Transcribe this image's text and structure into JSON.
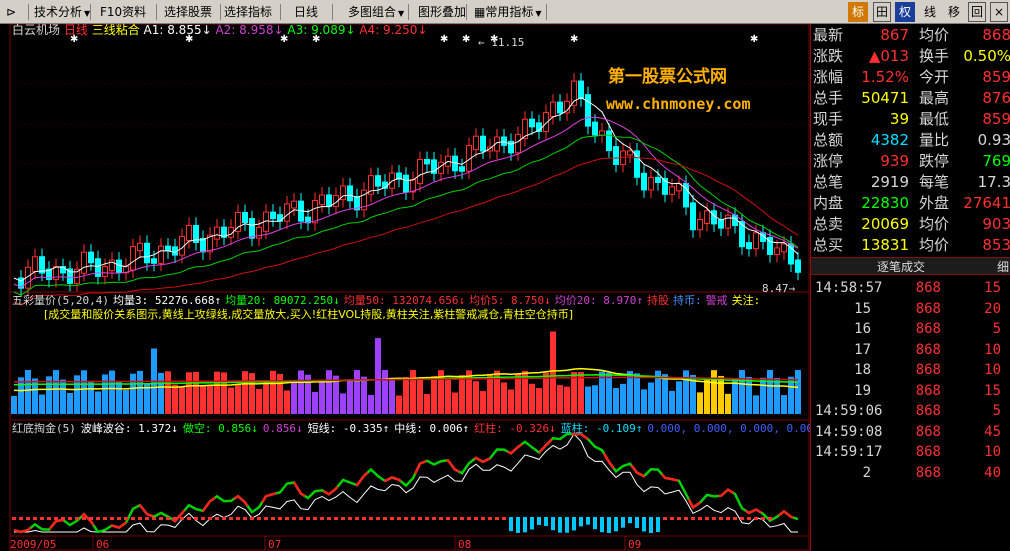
{
  "toolbar": {
    "menus": [
      "技术分析",
      "F10资料",
      "选择股票",
      "选择指标",
      "日线",
      "多图组合",
      "图形叠加",
      "常用指标"
    ],
    "right_tabs": [
      "标",
      "田",
      "权",
      "线",
      "移",
      "回"
    ],
    "active_tab": "标"
  },
  "title": {
    "stock_name": "白云机场",
    "period": "日线",
    "indicator": "三线粘合",
    "a1": "A1: 8.855↓",
    "a2": "A2: 8.958↓",
    "a3": "A3: 9.089↓",
    "a4": "A4: 9.250↓"
  },
  "watermark": {
    "line1": "第一股票公式网",
    "line2": "www.chnmoney.com"
  },
  "price_marks": {
    "high": "11.15",
    "low": "8.47"
  },
  "volume_pane": {
    "line1": [
      {
        "text": "五彩量价(5,20,4)",
        "color": "#d6d6d6"
      },
      {
        "text": "均量3: 52276.668↑",
        "color": "#ffffff"
      },
      {
        "text": "均量20: 89072.250↓",
        "color": "#00ff00"
      },
      {
        "text": "均量50: 132074.656↓",
        "color": "#ff3030"
      },
      {
        "text": "均价5: 8.750↓",
        "color": "#ff3030"
      },
      {
        "text": "均价20: 8.970↑",
        "color": "#d040d0"
      },
      {
        "text": "持股",
        "color": "#ff3030"
      },
      {
        "text": "持币:",
        "color": "#4090ff"
      },
      {
        "text": "警戒",
        "color": "#d040d0"
      },
      {
        "text": "关注:",
        "color": "#ffff00"
      }
    ],
    "line2": "[成交量和股价关系图示,黄线上攻绿线,成交量放大,买入!红柱VOL持股,黄柱关注,紫柱警戒减仓,青柱空仓持币]"
  },
  "macd_pane": {
    "items": [
      {
        "text": "红底掏金(5)",
        "color": "#d6d6d6"
      },
      {
        "text": "波峰波谷: 1.372↓",
        "color": "#ffffff"
      },
      {
        "text": "做空: 0.856↓",
        "color": "#00ff00"
      },
      {
        "text": "0.856↓",
        "color": "#d040d0"
      },
      {
        "text": "短线: -0.335↑",
        "color": "#ffffff"
      },
      {
        "text": "中线: 0.006↑",
        "color": "#ffffff"
      },
      {
        "text": "红柱: -0.326↓",
        "color": "#ff3030"
      },
      {
        "text": "蓝柱: -0.109↑",
        "color": "#00e0ff"
      },
      {
        "text": "0.000, 0.000, 0.000, 0.00",
        "color": "#4060ff"
      }
    ]
  },
  "x_axis": [
    "2009/05",
    "06",
    "07",
    "08",
    "09"
  ],
  "quote": {
    "rows": [
      {
        "l1": "最新",
        "v1": "867",
        "c1": "#ff3030",
        "l2": "均价",
        "v2": "868",
        "c2": "#ff3030"
      },
      {
        "l1": "涨跌",
        "v1": "▲013",
        "c1": "#ff3030",
        "l2": "换手",
        "v2": "0.50%",
        "c2": "#ffff00"
      },
      {
        "l1": "涨幅",
        "v1": "1.52%",
        "c1": "#ff3030",
        "l2": "今开",
        "v2": "859",
        "c2": "#ff3030"
      },
      {
        "l1": "总手",
        "v1": "50471",
        "c1": "#ffff00",
        "l2": "最高",
        "v2": "876",
        "c2": "#ff3030"
      },
      {
        "l1": "现手",
        "v1": "39",
        "c1": "#ffff00",
        "l2": "最低",
        "v2": "859",
        "c2": "#ff3030"
      },
      {
        "l1": "总额",
        "v1": "4382",
        "c1": "#00e0ff",
        "l2": "量比",
        "v2": "0.93",
        "c2": "#d6d6d6"
      },
      {
        "l1": "涨停",
        "v1": "939",
        "c1": "#ff3030",
        "l2": "跌停",
        "v2": "769",
        "c2": "#00ff00"
      },
      {
        "l1": "总笔",
        "v1": "2919",
        "c1": "#d6d6d6",
        "l2": "每笔",
        "v2": "17.3",
        "c2": "#d6d6d6"
      },
      {
        "l1": "内盘",
        "v1": "22830",
        "c1": "#00ff00",
        "l2": "外盘",
        "v2": "27641",
        "c2": "#ff3030"
      },
      {
        "l1": "总卖",
        "v1": "20069",
        "c1": "#ffff00",
        "l2": "均价",
        "v2": "903",
        "c2": "#ff3030"
      },
      {
        "l1": "总买",
        "v1": "13831",
        "c1": "#ffff00",
        "l2": "均价",
        "v2": "853",
        "c2": "#ff3030"
      }
    ]
  },
  "trades": {
    "header": "逐笔成交",
    "detail": "细",
    "rows": [
      {
        "time": "14:58:57",
        "price": "868",
        "vol": "15"
      },
      {
        "time": "15",
        "price": "868",
        "vol": "20"
      },
      {
        "time": "16",
        "price": "868",
        "vol": "5"
      },
      {
        "time": "17",
        "price": "868",
        "vol": "10"
      },
      {
        "time": "18",
        "price": "868",
        "vol": "10"
      },
      {
        "time": "19",
        "price": "868",
        "vol": "15"
      },
      {
        "time": "14:59:06",
        "price": "868",
        "vol": "5"
      },
      {
        "time": "14:59:08",
        "price": "868",
        "vol": "45"
      },
      {
        "time": "14:59:17",
        "price": "868",
        "vol": "10"
      },
      {
        "time": "2",
        "price": "868",
        "vol": "40"
      }
    ]
  },
  "colors": {
    "up": "#ff3030",
    "down": "#00ffff",
    "grid": "#7a0000",
    "ma_white": "#ffffff",
    "ma_magenta": "#e040e0",
    "ma_green": "#00d000",
    "ma_red": "#d01010"
  }
}
